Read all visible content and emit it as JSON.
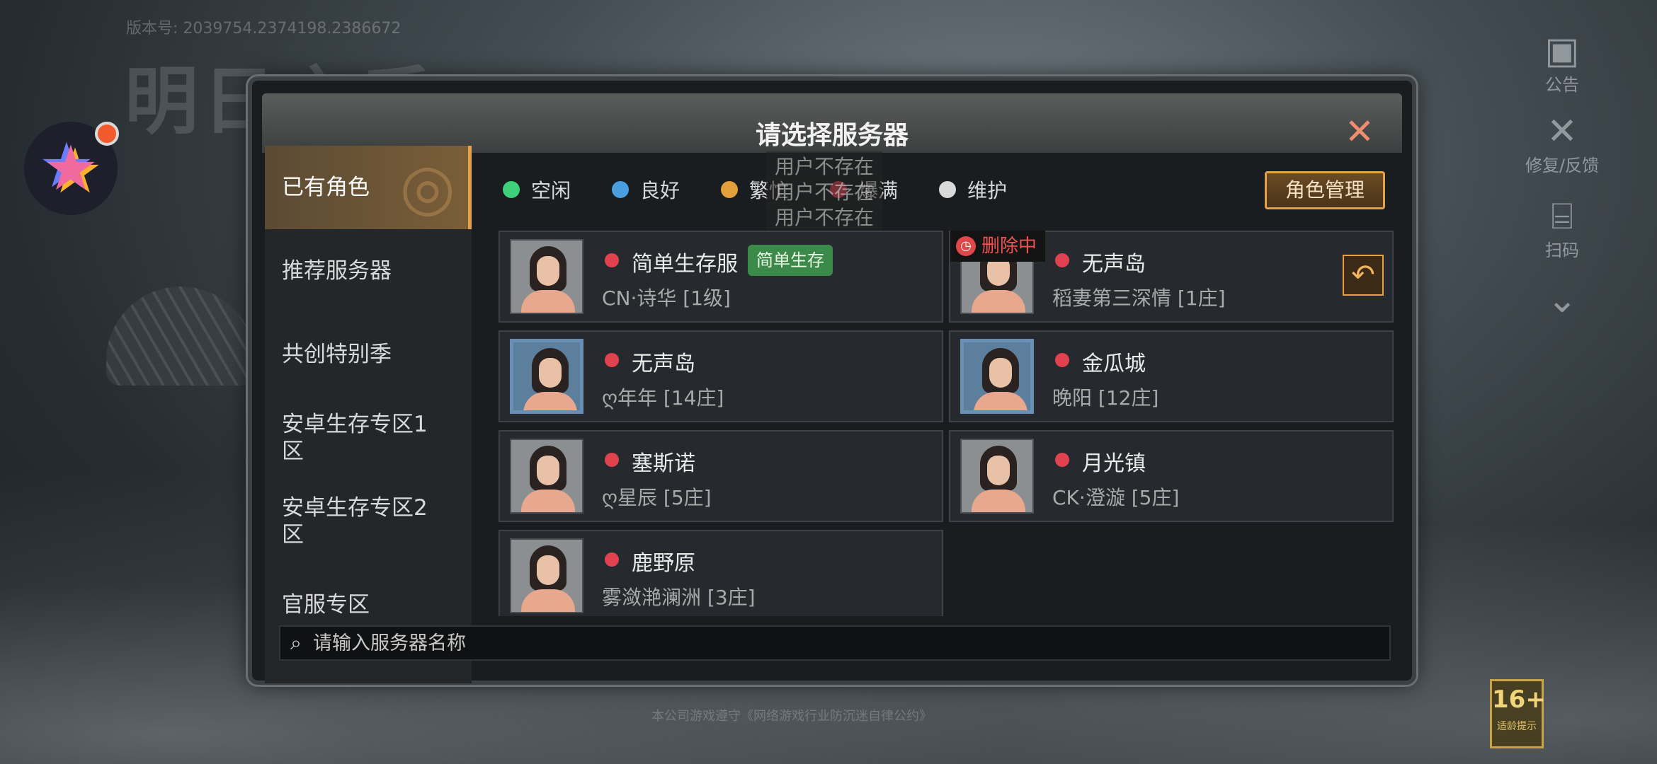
{
  "background": {
    "version": "版本号: 2039754.2374198.2386672",
    "game_logo": "明日之后",
    "footer_note": "本公司游戏遵守《网络游戏行业防沉迷自律公约》"
  },
  "right_tools": {
    "notice": "公告",
    "repair": "修复/反馈",
    "scan": "扫码"
  },
  "age_rating": {
    "value": "16+",
    "label": "适龄提示"
  },
  "dialog": {
    "title": "请选择服务器",
    "close_icon": "close-icon",
    "sidebar": [
      "已有角色",
      "推荐服务器",
      "共创特别季",
      "安卓生存专区1区",
      "安卓生存专区2区",
      "官服专区"
    ],
    "active_tab": "已有角色",
    "legend": [
      {
        "label": "空闲",
        "color": "#3ed07a"
      },
      {
        "label": "良好",
        "color": "#4a9ee0"
      },
      {
        "label": "繁忙",
        "color": "#e3a03a"
      },
      {
        "label": "爆满",
        "color": "#e0424f"
      },
      {
        "label": "维护",
        "color": "#d9d9d9"
      }
    ],
    "role_manage_label": "角色管理",
    "ghost_tips": [
      "用户不存在",
      "用户不存在",
      "用户不存在"
    ],
    "servers": [
      {
        "name": "简单生存服",
        "role": "CN·诗华 [1级]",
        "tag": "简单生存"
      },
      {
        "name": "无声岛",
        "role": "稻妻第三深情 [1庄]",
        "deleting": "删除中"
      },
      {
        "name": "无声岛",
        "role": "ღ年年 [14庄]"
      },
      {
        "name": "金瓜城",
        "role": "晚阳 [12庄]"
      },
      {
        "name": "塞斯诺",
        "role": "ღ星辰 [5庄]"
      },
      {
        "name": "月光镇",
        "role": "CK·澄漩 [5庄]"
      },
      {
        "name": "鹿野原",
        "role": "雾潋滟澜洲 [3庄]"
      }
    ],
    "search_placeholder": "请输入服务器名称"
  }
}
